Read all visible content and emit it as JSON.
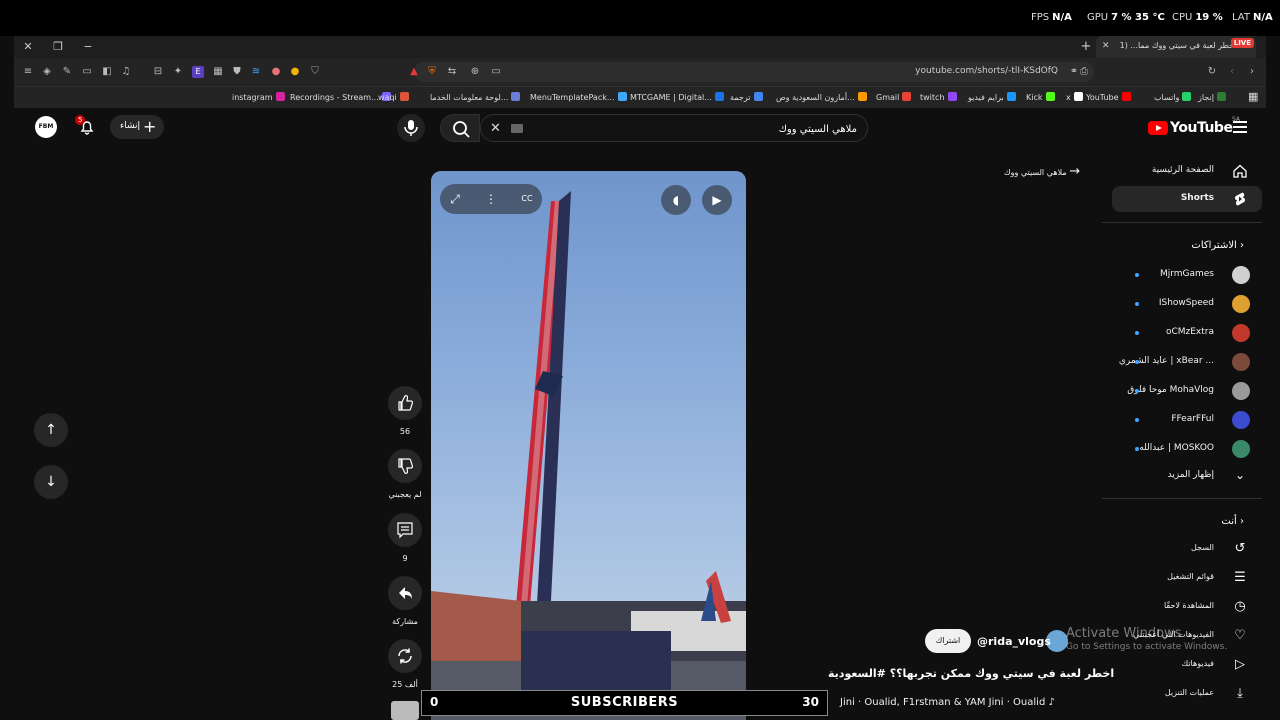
{
  "overlay": {
    "fps_label": "FPS",
    "fps_value": "N/A",
    "gpu_label": "GPU",
    "gpu_value": "7 %  35 °C",
    "cpu_label": "CPU",
    "cpu_value": "19 %",
    "lat_label": "LAT",
    "lat_value": "N/A"
  },
  "browser": {
    "tab_title": "خطر لعبة في سيتي ووك مما... (1",
    "live_badge": "LIVE",
    "url": "youtube.com/shorts/-tlI-KSdOfQ",
    "bookmarks": [
      {
        "label": "instagram",
        "color": "#d6249f"
      },
      {
        "label": "Recordings - Stream...",
        "color": "#7b61ff"
      },
      {
        "label": "waqi",
        "color": "#e0553a"
      },
      {
        "label": "لوحة معلومات الخدما...",
        "color": "#6b7fd7"
      },
      {
        "label": "MenuTemplatePack...",
        "color": "#3ea6ff"
      },
      {
        "label": "MTCGAME | Digital...",
        "color": "#1a73e8"
      },
      {
        "label": "ترجمة",
        "color": "#4285f4"
      },
      {
        "label": "أمازون السعودية وص...",
        "color": "#ff9900"
      },
      {
        "label": "Gmail",
        "color": "#ea4335"
      },
      {
        "label": "twitch",
        "color": "#9146ff"
      },
      {
        "label": "برايم فيديو",
        "color": "#1a98ff"
      },
      {
        "label": "Kick",
        "color": "#53fc18"
      },
      {
        "label": "x",
        "color": "#ffffff"
      },
      {
        "label": "YouTube",
        "color": "#ff0000"
      },
      {
        "label": "واتساب",
        "color": "#25d366"
      },
      {
        "label": "إنجاز",
        "color": "#2e7d32"
      }
    ]
  },
  "header": {
    "logo_text": "YouTube",
    "country_code": "SA",
    "search_value": "ملاهي السيتي ووك",
    "create_label": "إنشاء",
    "notifications_count": "5",
    "avatar_text": "FBM"
  },
  "sidebar": {
    "home": "الصفحة الرئيسية",
    "shorts": "Shorts",
    "subscriptions_heading": "الاشتراكات",
    "channels": [
      {
        "name": "MjrmGames",
        "color": "#d0d0d0"
      },
      {
        "name": "IShowSpeed",
        "color": "#e0a030"
      },
      {
        "name": "oCMzExtra",
        "color": "#c0392b"
      },
      {
        "name": "عايد الشمري | xBear ...",
        "color": "#7a4a3a"
      },
      {
        "name": "موحا فلوق MohaVlog",
        "color": "#9a9a9a"
      },
      {
        "name": "FFearFFul",
        "color": "#3a4bd0"
      },
      {
        "name": "عبدالله | MOSKOO",
        "color": "#3a8a6a"
      }
    ],
    "show_more": "إظهار المزيد",
    "you_heading": "أنت",
    "you_items": [
      "السجل",
      "قوائم التشغيل",
      "المشاهدة لاحقًا",
      "الفيديوهات التي أعجبتني",
      "فيديوهاتك",
      "عمليات التنزيل"
    ]
  },
  "short": {
    "back_label": "ملاهي السيتي ووك",
    "like_count": "56",
    "dislike_label": "لم يعجبني",
    "comment_count": "9",
    "share_label": "مشاركة",
    "remix_count": "25 ألف",
    "channel": "@rida_vlogs",
    "subscribe_label": "اشتراك",
    "title": "اخطر لعبة في سيتي ووك ممكن تجربها؟؟ #السعودية",
    "music": "Jini · Oualid, F1rstman & YAM   Jini · Oualid ♪"
  },
  "watermark": {
    "line1": "Activate Windows",
    "line2": "Go to Settings to activate Windows."
  },
  "sub_counter": {
    "left": "0",
    "center": "SUBSCRIBERS",
    "right": "30"
  },
  "colors": {
    "background": "#0f0f0f",
    "brand_red": "#ff0000",
    "accent_blue": "#3ea6ff"
  }
}
